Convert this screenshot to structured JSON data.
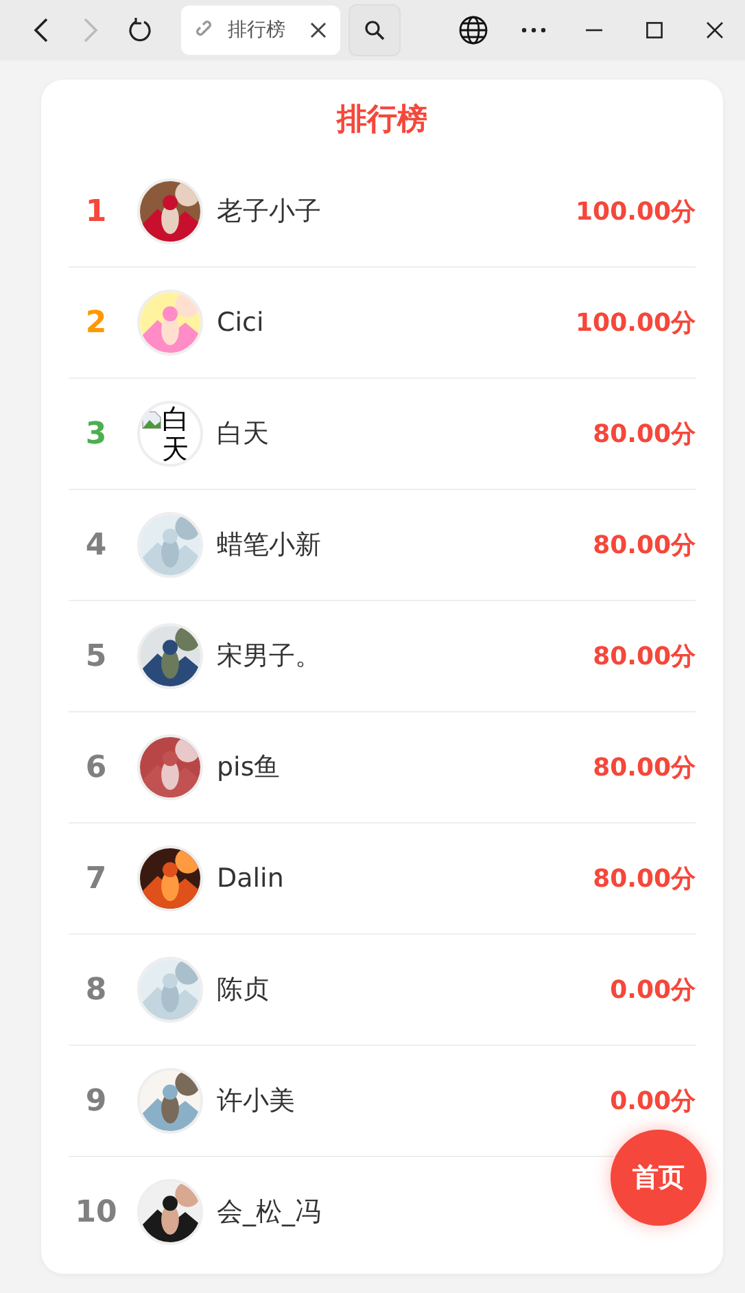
{
  "browser": {
    "back_disabled": false,
    "forward_disabled": true,
    "tab": {
      "title": "排行榜"
    }
  },
  "page": {
    "title": "排行榜",
    "rows": [
      {
        "rank": "1",
        "color": "#f5473b",
        "name": "老子小子",
        "score": "100.00分"
      },
      {
        "rank": "2",
        "color": "#ff9800",
        "name": "Cici",
        "score": "100.00分"
      },
      {
        "rank": "3",
        "color": "#4caf50",
        "avatar": {
          "kind": "broken",
          "alt": "白天"
        },
        "name": "白天",
        "score": "80.00分"
      },
      {
        "rank": "4",
        "color": "#808080",
        "name": "蜡笔小新",
        "score": "80.00分"
      },
      {
        "rank": "5",
        "color": "#808080",
        "name": "宋男子。",
        "score": "80.00分"
      },
      {
        "rank": "6",
        "color": "#808080",
        "name": "pis鱼",
        "score": "80.00分"
      },
      {
        "rank": "7",
        "color": "#808080",
        "name": "Dalin",
        "score": "80.00分"
      },
      {
        "rank": "8",
        "color": "#808080",
        "name": "陈贞",
        "score": "0.00分"
      },
      {
        "rank": "9",
        "color": "#808080",
        "name": "许小美",
        "score": "0.00分"
      },
      {
        "rank": "10",
        "color": "#808080",
        "name": "会_松_冯"
      }
    ],
    "home_button": "首页"
  }
}
